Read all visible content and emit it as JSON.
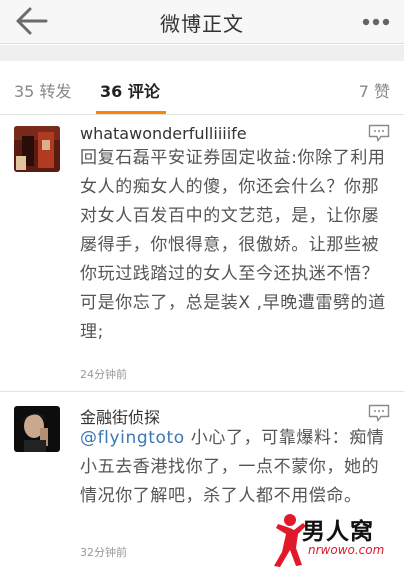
{
  "navbar": {
    "title": "微博正文",
    "back_icon": "back-arrow-icon",
    "more_icon": "more-dots-icon"
  },
  "stats": {
    "repost_label": "35 转发",
    "comment_label": "36 评论",
    "like_label": "7 赞",
    "active_tab": "comment",
    "accent_color": "#ff8200"
  },
  "comments": [
    {
      "username": "whatawonderfulliiiife",
      "text": "回复石磊平安证券固定收益:你除了利用女人的痴女人的傻，你还会什么？你那对女人百发百中的文艺范，是，让你屡屡得手，你恨得意，很傲娇。让那些被你玩过践踏过的女人至今还执迷不悟？可是你忘了，总是装X ,早晚遭雷劈的道理;",
      "time": "24分钟前"
    },
    {
      "username": "金融街侦探",
      "mention": "@flyingtoto",
      "text": " 小心了，可靠爆料：痴情小五去香港找你了，一点不蒙你，她的情况你了解吧，杀了人都不用偿命。",
      "time": "32分钟前"
    }
  ],
  "watermark": {
    "brand": "男人窝",
    "url": "nrwowo.com"
  },
  "colors": {
    "link": "#3b77b5",
    "watermark_red": "#e0192b"
  }
}
